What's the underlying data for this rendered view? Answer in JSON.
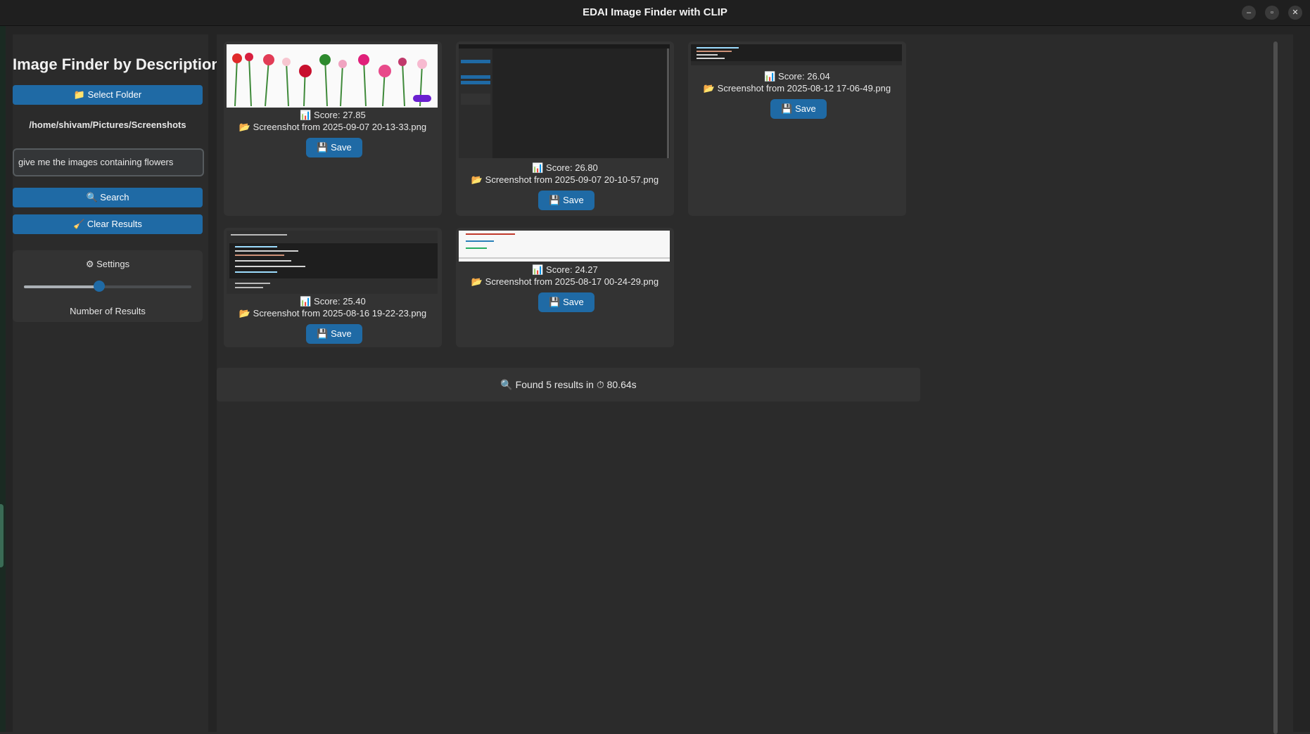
{
  "window": {
    "title": "EDAI Image Finder with CLIP",
    "minimize_glyph": "–",
    "maximize_glyph": "▫",
    "close_glyph": "✕"
  },
  "sidebar": {
    "title": "Image Finder by Description",
    "select_folder_label": "📁 Select Folder",
    "folder_path": "/home/shivam/Pictures/Screenshots",
    "query_value": "give me the images containing flowers",
    "search_label": "🔍 Search",
    "clear_label": "🧹 Clear Results",
    "settings_label": "⚙ Settings",
    "num_results_label": "Number of Results",
    "num_results_slider_fraction": 0.45
  },
  "results": [
    {
      "score": "📊 Score: 27.85",
      "file": "📂 Screenshot from 2025-09-07 20-13-33.png",
      "save": "💾 Save",
      "thumb": "flowers"
    },
    {
      "score": "📊 Score: 26.80",
      "file": "📂 Screenshot from 2025-09-07 20-10-57.png",
      "save": "💾 Save",
      "thumb": "app-dark"
    },
    {
      "score": "📊 Score: 26.04",
      "file": "📂 Screenshot from 2025-08-12 17-06-49.png",
      "save": "💾 Save",
      "thumb": "code-dark-short"
    },
    {
      "score": "📊 Score: 25.40",
      "file": "📂 Screenshot from 2025-08-16 19-22-23.png",
      "save": "💾 Save",
      "thumb": "code-dark"
    },
    {
      "score": "📊 Score: 24.27",
      "file": "📂 Screenshot from 2025-08-17 00-24-29.png",
      "save": "💾 Save",
      "thumb": "code-light"
    }
  ],
  "status": "🔍 Found 5 results in ⏱ 80.64s",
  "colors": {
    "accent": "#1f6aa5",
    "background": "#242424",
    "panel": "#2b2b2b",
    "card": "#333333"
  }
}
